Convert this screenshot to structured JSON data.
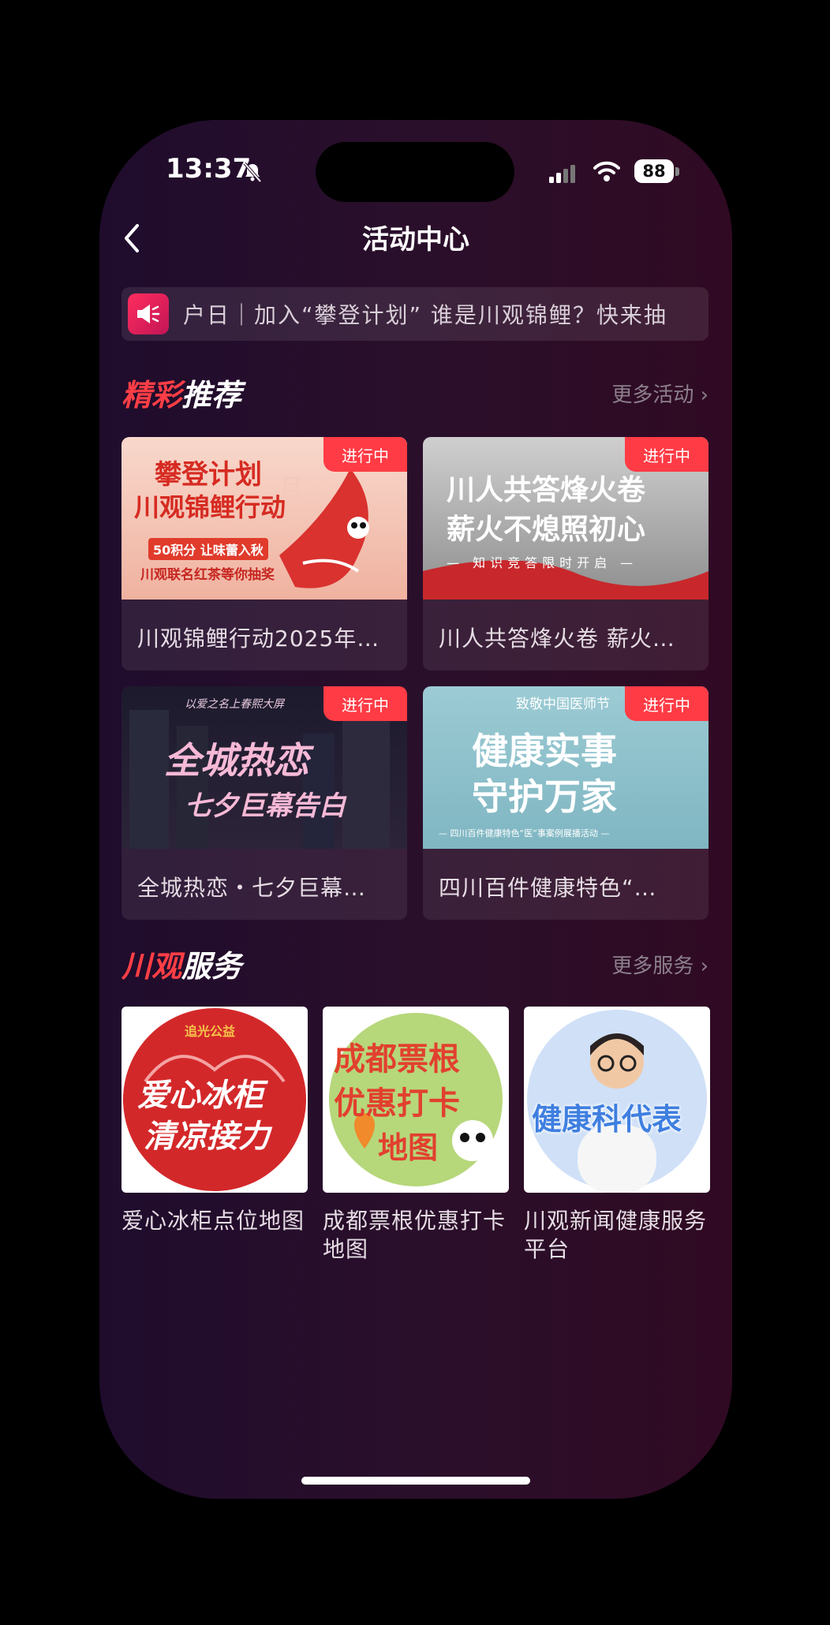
{
  "status": {
    "time": "13:37",
    "battery": "88"
  },
  "header": {
    "title": "活动中心"
  },
  "notice": {
    "text": "户日｜加入“攀登计划” 谁是川观锦鲤？快来抽"
  },
  "recommend": {
    "title_accent": "精彩",
    "title_rest": "推荐",
    "more": "更多活动 ›",
    "cards": [
      {
        "badge": "进行中",
        "caption": "川观锦鲤行动2025年…",
        "thumb_lines": [
          "攀登计划",
          "川观锦鲤行动",
          "50积分 让味蕾入秋",
          "川观联名红茶等你抽奖"
        ]
      },
      {
        "badge": "进行中",
        "caption": "川人共答烽火卷 薪火…",
        "thumb_lines": [
          "川人共答烽火卷",
          "薪火不熄照初心",
          "— 知识竞答限时开启 —"
        ]
      },
      {
        "badge": "进行中",
        "caption": "全城热恋・七夕巨幕…",
        "thumb_lines": [
          "以爱之名上春熙大屏",
          "全城热恋",
          "七夕巨幕告白"
        ]
      },
      {
        "badge": "进行中",
        "caption": "四川百件健康特色“…",
        "thumb_lines": [
          "致敬中国医师节",
          "健康实事",
          "守护万家",
          "— 四川百件健康特色“医”事案例展播活动 —"
        ]
      }
    ]
  },
  "services": {
    "title_accent": "川观",
    "title_rest": "服务",
    "more": "更多服务 ›",
    "items": [
      {
        "caption": "爱心冰柜点位地图",
        "thumb_lines": [
          "追光公益",
          "爱心冰柜",
          "清凉接力"
        ]
      },
      {
        "caption": "成都票根优惠打卡地图",
        "thumb_lines": [
          "成都票根",
          "优惠打卡",
          "地图"
        ]
      },
      {
        "caption": "川观新闻健康服务平台",
        "thumb_lines": [
          "健康科代表"
        ]
      }
    ]
  },
  "colors": {
    "accent": "#ff3b45",
    "badge": "#ff3b45"
  }
}
